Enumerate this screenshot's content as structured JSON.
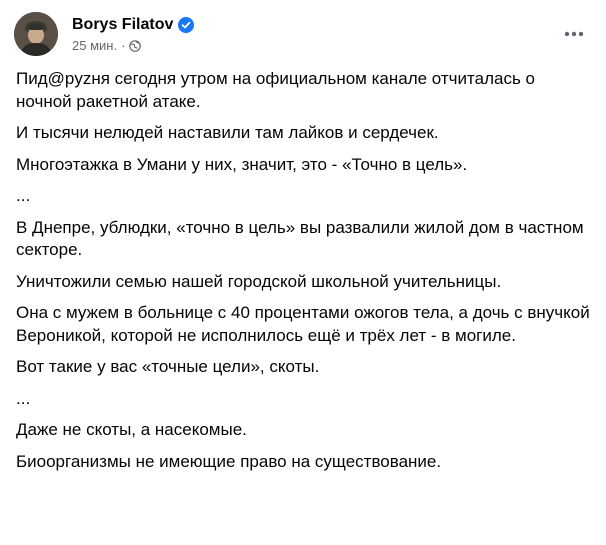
{
  "post": {
    "author": "Borys Filatov",
    "time": "25 мин.",
    "separator": "·",
    "icons": {
      "verified": "verified-badge-icon",
      "privacy": "globe-icon",
      "more": "more-options-icon"
    },
    "colors": {
      "verified": "#1877f2",
      "muted": "#65676b",
      "text": "#050505"
    },
    "paragraphs": [
      "Пид@pyzня сегодня утром на официальном канале отчиталась о ночной ракетной атаке.",
      "И тысячи нелюдей наставили там лайков и сердечек.",
      "Многоэтажка в Умани у них, значит, это - «Точно в цель».",
      "...",
      "В Днепре, ублюдки, «точно в цель» вы развалили жилой дом в частном секторе.",
      "Уничтожили семью нашей городской школьной учительницы.",
      "Она с мужем в больнице с 40 процентами ожогов тела, а дочь с внучкой Вероникой, которой не исполнилось ещё и трёх лет - в могиле.",
      "Вот такие у вас «точные цели», скоты.",
      "...",
      "Даже не скоты, а насекомые.",
      "Биоорганизмы не имеющие право на существование."
    ]
  }
}
